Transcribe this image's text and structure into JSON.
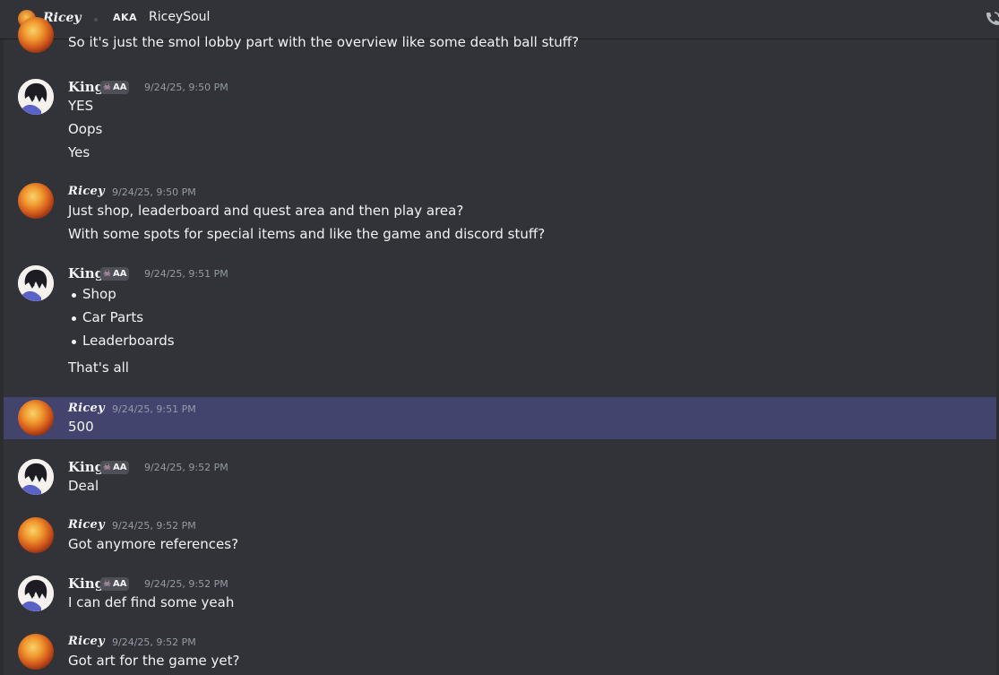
{
  "header": {
    "name": "Ricey",
    "aka_label": "AKA",
    "alias": "RiceySoul"
  },
  "colors": {
    "background": "#313338",
    "highlight": "#42446e",
    "text": "#f2f3f5",
    "timestamp": "#949ba4"
  },
  "top_message": {
    "text": "So it's just the smol lobby part with the overview like some death ball stuff?"
  },
  "messages": [
    {
      "author": "King",
      "badge": "AA",
      "badge_icon": "skull-icon",
      "timestamp": "9/24/25, 9:50 PM",
      "lines": [
        "YES",
        "Oops",
        "Yes"
      ]
    },
    {
      "author": "Ricey",
      "timestamp": "9/24/25, 9:50 PM",
      "lines": [
        "Just shop, leaderboard and quest area and then play area?",
        "With some spots for special items and like the game and discord stuff?"
      ]
    },
    {
      "author": "King",
      "badge": "AA",
      "badge_icon": "skull-icon",
      "timestamp": "9/24/25, 9:51 PM",
      "bullets": [
        "Shop",
        "Car Parts",
        "Leaderboards"
      ],
      "lines": [
        "That's all"
      ]
    },
    {
      "author": "Ricey",
      "timestamp": "9/24/25, 9:51 PM",
      "highlighted": true,
      "lines": [
        "500"
      ]
    },
    {
      "author": "King",
      "badge": "AA",
      "badge_icon": "skull-icon",
      "timestamp": "9/24/25, 9:52 PM",
      "lines": [
        "Deal"
      ]
    },
    {
      "author": "Ricey",
      "timestamp": "9/24/25, 9:52 PM",
      "lines": [
        "Got anymore references?"
      ]
    },
    {
      "author": "King",
      "badge": "AA",
      "badge_icon": "skull-icon",
      "timestamp": "9/24/25, 9:52 PM",
      "lines": [
        "I can def find some yeah"
      ]
    },
    {
      "author": "Ricey",
      "timestamp": "9/24/25, 9:52 PM",
      "lines": [
        "Got art for the game yet?"
      ]
    }
  ]
}
